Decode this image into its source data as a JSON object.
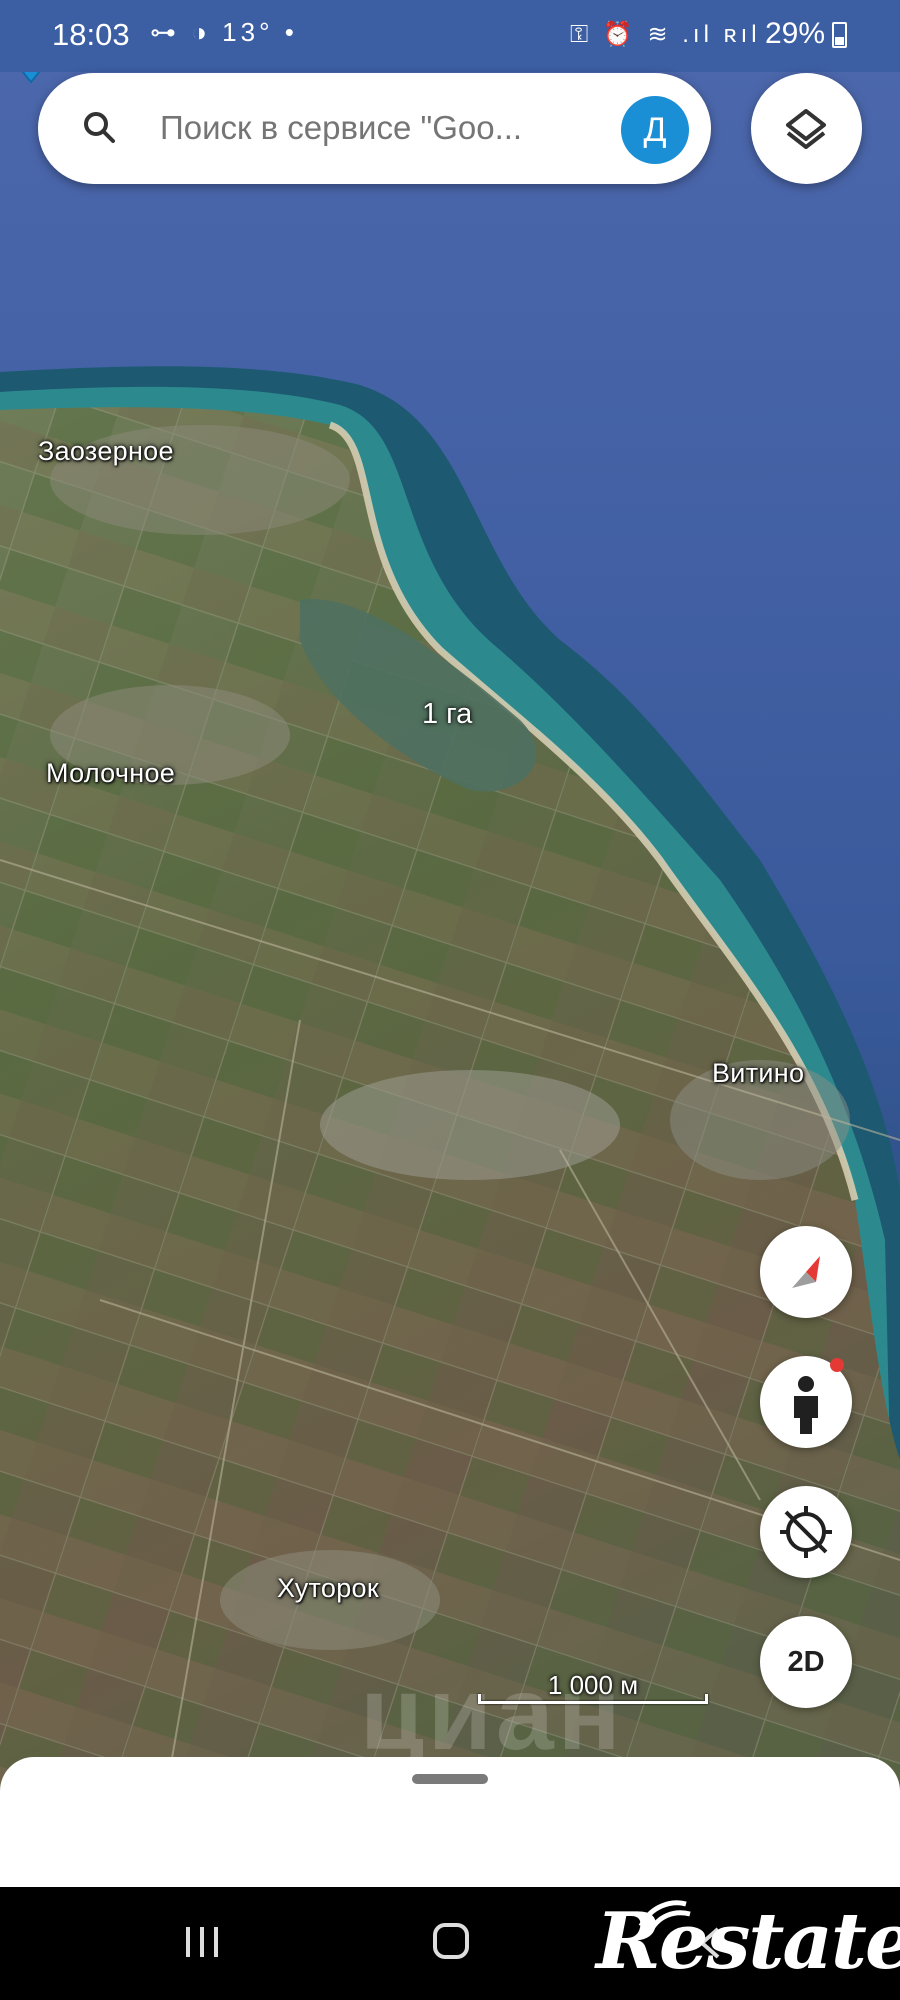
{
  "status_bar": {
    "time": "18:03",
    "left_icons": "⊶ ◑ 13° •",
    "right_icons": "⚿ ⏰ ≋ .ıl ʀıl",
    "battery": "29%"
  },
  "search": {
    "placeholder": "Поиск в сервисе \"Goo...",
    "avatar_letter": "Д"
  },
  "map": {
    "places": {
      "zaozernoe": "Заозерное",
      "molochnoe": "Молочное",
      "vitino": "Витино",
      "khutorok": "Хуторок"
    },
    "area_label": "1 га",
    "scale_label": "1 000 м",
    "view_mode": "2D"
  },
  "watermarks": {
    "cian": "циан",
    "restate": "Restate"
  },
  "colors": {
    "status_bar": "#3c5ea3",
    "pin": "#1a8fd6",
    "avatar": "#1a8fd6",
    "sea": "#3f5fa5"
  }
}
